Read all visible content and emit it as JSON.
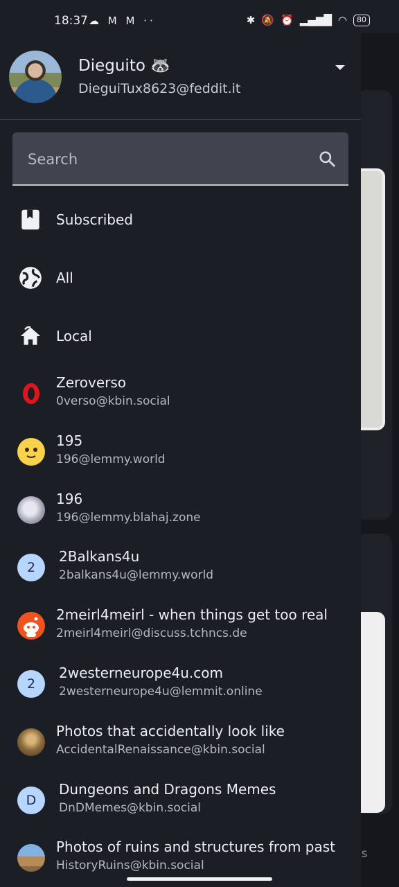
{
  "status": {
    "time": "18:37",
    "left_icons": "☁ M M ··",
    "battery": "80"
  },
  "account": {
    "name": "Dieguito 🦝",
    "handle": "DieguiTux8623@feddit.it"
  },
  "search": {
    "placeholder": "Search"
  },
  "nav": [
    {
      "label": "Subscribed",
      "icon": "bookmark-icon"
    },
    {
      "label": "All",
      "icon": "globe-icon"
    },
    {
      "label": "Local",
      "icon": "home-icon"
    }
  ],
  "communities": [
    {
      "title": "Zeroverso",
      "sub": "0verso@kbin.social",
      "icon": "zeroverso-logo"
    },
    {
      "title": "195",
      "sub": "196@lemmy.world",
      "icon": "emoji-face-icon"
    },
    {
      "title": "196",
      "sub": "196@lemmy.blahaj.zone",
      "icon": "marble-avatar"
    },
    {
      "title": "2Balkans4u",
      "sub": "2balkans4u@lemmy.world",
      "letter": "2"
    },
    {
      "title": "2meirl4meirl - when things get too real",
      "sub": "2meirl4meirl@discuss.tchncs.de",
      "icon": "reddit-alien-icon"
    },
    {
      "title": "2westerneurope4u.com",
      "sub": "2westerneurope4u@lemmit.online",
      "letter": "2"
    },
    {
      "title": "Photos that accidentally look like",
      "sub": "AccidentalRenaissance@kbin.social",
      "icon": "painting-avatar"
    },
    {
      "title": "Dungeons and Dragons Memes",
      "sub": "DnDMemes@kbin.social",
      "letter": "D"
    },
    {
      "title": "Photos of ruins and structures from past",
      "sub": "HistoryRuins@kbin.social",
      "icon": "ruins-avatar"
    }
  ],
  "background": {
    "settings_fragment": "ngs"
  }
}
